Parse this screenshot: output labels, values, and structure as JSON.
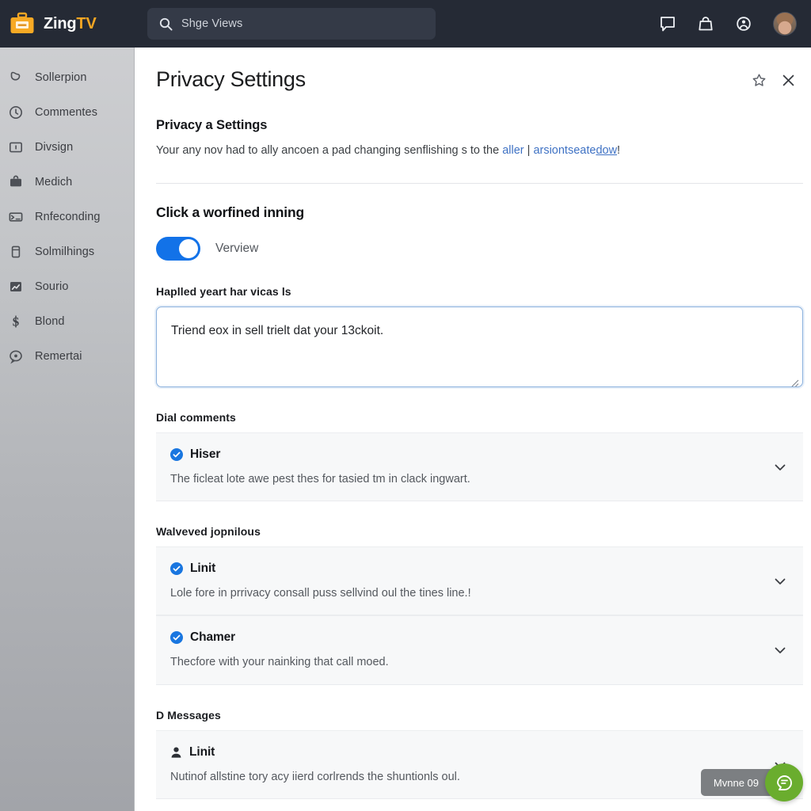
{
  "topbar": {
    "logo_icon": "briefcase-icon",
    "brand_first": "Zing",
    "brand_second": "TV",
    "search": {
      "icon": "search-icon",
      "value": "Shge Views"
    },
    "actions": [
      {
        "name": "comment-icon",
        "label": "comment-icon"
      },
      {
        "name": "bag-icon",
        "label": "bag-icon"
      },
      {
        "name": "account-circle-icon",
        "label": "account-circle-icon"
      }
    ],
    "avatar": "user-avatar"
  },
  "sidebar": {
    "items": [
      {
        "label": "Sollerpion",
        "icon": "bookmark-icon"
      },
      {
        "label": "Commentes",
        "icon": "clock-icon"
      },
      {
        "label": "Divsign",
        "icon": "id-card-icon"
      },
      {
        "label": "Medich",
        "icon": "briefcase-solid-icon"
      },
      {
        "label": "Rnfeconding",
        "icon": "inbox-icon"
      },
      {
        "label": "Solmilhings",
        "icon": "device-icon"
      },
      {
        "label": "Sourio",
        "icon": "chart-icon"
      },
      {
        "label": "Blond",
        "icon": "dollar-icon"
      },
      {
        "label": "Remertai",
        "icon": "chat-bubble-icon"
      }
    ]
  },
  "page": {
    "title": "Privacy Settings",
    "star_icon": "star-icon",
    "close_icon": "close-icon",
    "section_title": "Privacy a Settings",
    "desc_pre": "Your any nov had to ally ancoen a pad changing senflishing s to the ",
    "desc_link1": "aller",
    "desc_sep": " | ",
    "desc_link2": "arsiontseate",
    "desc_link2_underline": "dow",
    "desc_post": "!"
  },
  "toggle_section": {
    "title": "Click a worfined inning",
    "toggle_on": true,
    "toggle_label": "Verview"
  },
  "textarea_section": {
    "label": "Haplled yeart har vicas ls",
    "value": "Triend eox in sell trielt dat your 13ckoit."
  },
  "groups": [
    {
      "label": "Dial comments",
      "cards": [
        {
          "icon": "check-circle-icon",
          "title": "Hiser",
          "desc": "The ficleat lote awe pest thes for tasied tm in clack ingwart.",
          "chevron": "chevron-down-icon"
        }
      ]
    },
    {
      "label": "Walveved jopnilous",
      "cards": [
        {
          "icon": "check-circle-icon",
          "title": "Linit",
          "desc": "Lole fore in prrivacy consall puss sellvind oul the tines line.!",
          "chevron": "chevron-down-icon"
        },
        {
          "icon": "check-circle-icon",
          "title": "Chamer",
          "desc": "Thecfore with your nainking that call moed.",
          "chevron": "chevron-down-icon"
        }
      ]
    },
    {
      "label": "D Messages",
      "cards": [
        {
          "icon": "person-icon",
          "title": "Linit",
          "desc": "Nutinof allstine tory acy iierd corlrends the shuntionls oul.",
          "chevron": "chevron-down-icon"
        }
      ]
    }
  ],
  "chat_widget": {
    "pill_label": "Mvnne 09",
    "fab_icon": "chat-leaf-icon"
  },
  "colors": {
    "topbar_bg": "#252a35",
    "brand_accent": "#f5a623",
    "toggle_on": "#1272e8",
    "link": "#3f72c4",
    "check": "#1976e0",
    "chat_fab": "#6aad2e",
    "card_bg": "#f7f8f9"
  }
}
